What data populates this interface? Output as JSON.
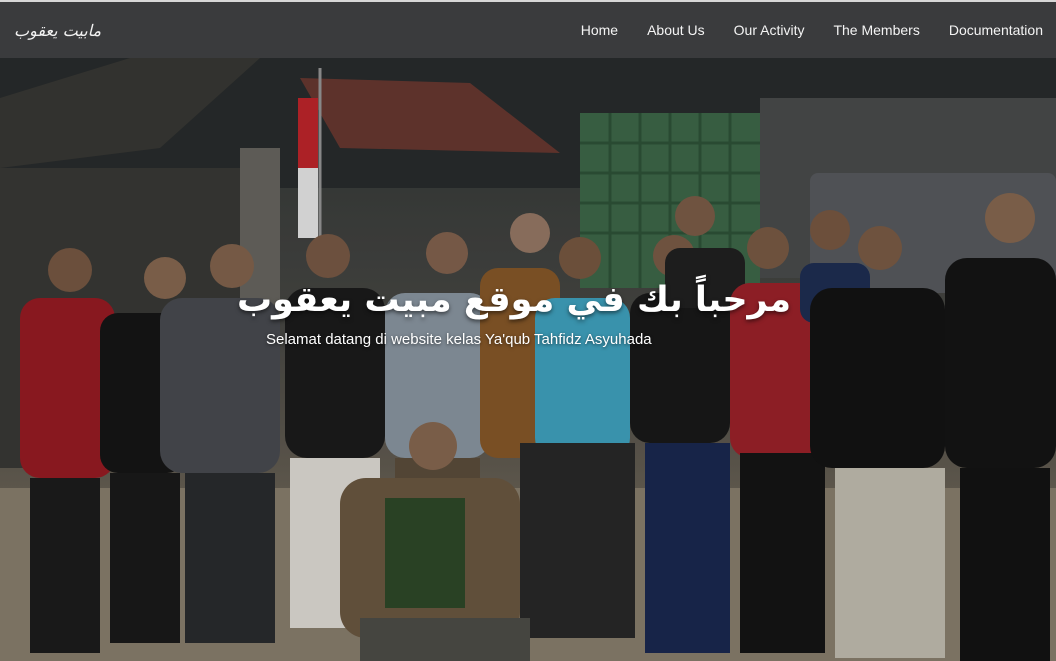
{
  "navbar": {
    "brand": "مابيت يعقوب",
    "links": [
      "Home",
      "About Us",
      "Our Activity",
      "The Members",
      "Documentation"
    ]
  },
  "hero": {
    "title": "مرحباً بك في موقع مبيت يعقوب",
    "subtitle": "Selamat datang di website kelas Ya'qub Tahfidz Asyuhada",
    "image": "group-photo-of-students"
  },
  "colors": {
    "navbar_bg": "#3a3b3d",
    "nav_text": "#f4f4f4",
    "hero_text": "#ffffff"
  }
}
